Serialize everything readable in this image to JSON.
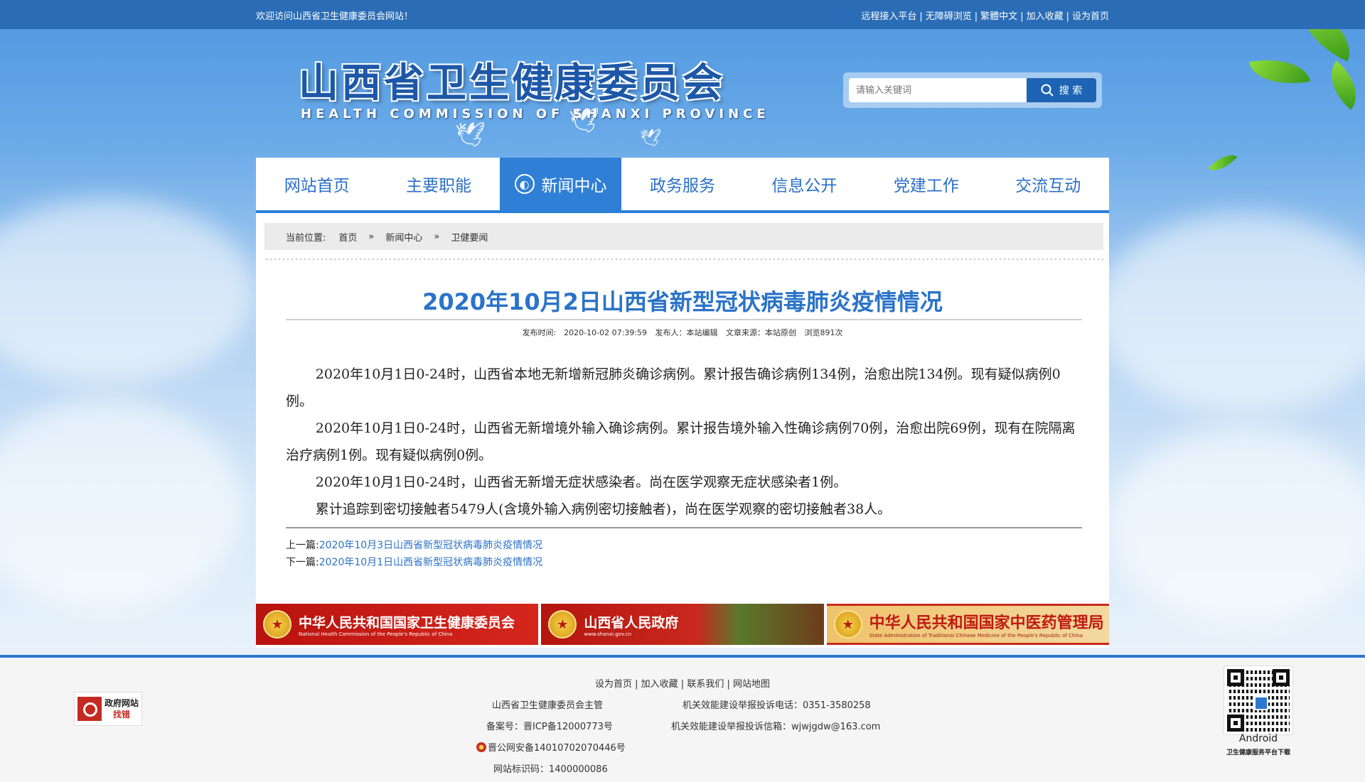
{
  "topbar": {
    "welcome": "欢迎访问山西省卫生健康委员会网站！",
    "links": [
      "远程接入平台",
      "无障碍浏览",
      "繁體中文",
      "加入收藏",
      "设为首页"
    ]
  },
  "header": {
    "title_cn": "山西省卫生健康委员会",
    "title_en": "HEALTH COMMISSION OF SHANXI PROVINCE"
  },
  "search": {
    "placeholder": "请输入关键词",
    "button_label": "搜 索"
  },
  "nav": {
    "items": [
      {
        "label": "网站首页",
        "active": false
      },
      {
        "label": "主要职能",
        "active": false
      },
      {
        "label": "新闻中心",
        "active": true
      },
      {
        "label": "政务服务",
        "active": false
      },
      {
        "label": "信息公开",
        "active": false
      },
      {
        "label": "党建工作",
        "active": false
      },
      {
        "label": "交流互动",
        "active": false
      }
    ]
  },
  "breadcrumb": {
    "prefix": "当前位置:",
    "items": [
      "首页",
      "新闻中心",
      "卫健要闻"
    ],
    "separator": "»"
  },
  "article": {
    "title": "2020年10月2日山西省新型冠状病毒肺炎疫情情况",
    "meta": {
      "publish_time": "发布时间:　2020-10-02 07:39:59",
      "publisher": "发布人：本站编辑",
      "source": "文章来源：本站原创",
      "views": "浏览891次"
    },
    "paragraphs": [
      "2020年10月1日0-24时，山西省本地无新增新冠肺炎确诊病例。累计报告确诊病例134例，治愈出院134例。现有疑似病例0例。",
      "2020年10月1日0-24时，山西省无新增境外输入确诊病例。累计报告境外输入性确诊病例70例，治愈出院69例，现有在院隔离治疗病例1例。现有疑似病例0例。",
      "2020年10月1日0-24时，山西省无新增无症状感染者。尚在医学观察无症状感染者1例。",
      "累计追踪到密切接触者5479人(含境外输入病例密切接触者)，尚在医学观察的密切接触者38人。"
    ],
    "prev_label": "上一篇:",
    "prev_link": "2020年10月3日山西省新型冠状病毒肺炎疫情情况",
    "next_label": "下一篇:",
    "next_link": "2020年10月1日山西省新型冠状病毒肺炎疫情情况"
  },
  "banners": [
    {
      "cn": "中华人民共和国国家卫生健康委员会",
      "en": "National Health Commission of the People's Republic of China"
    },
    {
      "cn": "山西省人民政府",
      "en": "www.shanxi.gov.cn"
    },
    {
      "cn": "中华人民共和国国家中医药管理局",
      "en": "State Administration of Traditional Chinese Medicine of the People's Republic of China"
    }
  ],
  "footer": {
    "links": [
      "设为首页",
      "加入收藏",
      "联系我们",
      "网站地图"
    ],
    "sponsor": "山西省卫生健康委员会主管",
    "icp": "备案号：晋ICP备12000773号",
    "police": "晋公网安备14010702070446号",
    "site_id": "网站标识码：1400000086",
    "phone": "机关效能建设举报投诉电话：0351-3580258",
    "email": "机关效能建设举报投诉信箱：wjwjgdw@163.com",
    "gov_badge_line1": "政府网站",
    "gov_badge_line2": "找错",
    "qr_label": "Android",
    "qr_caption": "卫生健康服务平台下载"
  },
  "colors": {
    "nav_active": "#2f7fd6",
    "title_blue": "#2b73c8",
    "link_blue": "#2a72c8",
    "topbar": "#2a6cb6"
  }
}
